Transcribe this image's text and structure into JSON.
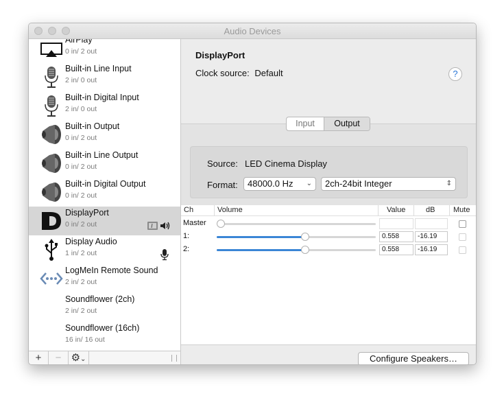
{
  "window": {
    "title": "Audio Devices"
  },
  "devices": [
    {
      "name": "AirPlay",
      "io": "0 in/ 2 out",
      "icon": "airplay-icon"
    },
    {
      "name": "Built-in Line Input",
      "io": "2 in/ 0 out",
      "icon": "microphone-icon"
    },
    {
      "name": "Built-in Digital Input",
      "io": "2 in/ 0 out",
      "icon": "microphone-icon"
    },
    {
      "name": "Built-in Output",
      "io": "0 in/ 2 out",
      "icon": "speaker-icon"
    },
    {
      "name": "Built-in Line Output",
      "io": "0 in/ 2 out",
      "icon": "speaker-icon"
    },
    {
      "name": "Built-in Digital Output",
      "io": "0 in/ 2 out",
      "icon": "speaker-icon"
    },
    {
      "name": "DisplayPort",
      "io": "0 in/ 2 out",
      "icon": "displayport-icon",
      "selected": true,
      "badges": [
        "finder-icon",
        "speaker-icon"
      ]
    },
    {
      "name": "Display Audio",
      "io": "1 in/ 2 out",
      "icon": "usb-icon",
      "badges": [
        "microphone-icon"
      ]
    },
    {
      "name": "LogMeIn Remote Sound",
      "io": "2 in/ 2 out",
      "icon": "logmein-icon"
    },
    {
      "name": "Soundflower (2ch)",
      "io": "2 in/ 2 out",
      "icon": "none"
    },
    {
      "name": "Soundflower (16ch)",
      "io": "16 in/ 16 out",
      "icon": "none"
    }
  ],
  "sidebar_footer": {
    "add": "+",
    "remove": "−",
    "gear": "⚙",
    "gear_menu": "⌄"
  },
  "main": {
    "device_title": "DisplayPort",
    "clock_label": "Clock source:",
    "clock_value": "Default",
    "help": "?",
    "tabs": [
      "Input",
      "Output"
    ],
    "selected_tab": "Output",
    "source_label": "Source:",
    "source_value": "LED Cinema Display",
    "format_label": "Format:",
    "rate": "48000.0 Hz",
    "bitformat": "2ch-24bit Integer"
  },
  "table": {
    "headers": {
      "ch": "Ch",
      "volume": "Volume",
      "value": "Value",
      "db": "dB",
      "mute": "Mute"
    },
    "rows": [
      {
        "label": "Master",
        "level": 0.0,
        "value": "",
        "db": "",
        "enabled": false
      },
      {
        "label": "1:",
        "level": 0.558,
        "value": "0.558",
        "db": "-16.19",
        "enabled": true
      },
      {
        "label": "2:",
        "level": 0.558,
        "value": "0.558",
        "db": "-16.19",
        "enabled": true
      }
    ]
  },
  "configure_button": "Configure Speakers…",
  "colors": {
    "accent": "#3b86d6",
    "selected_row": "#d6d6d6",
    "help_accent": "#2a76d6"
  }
}
